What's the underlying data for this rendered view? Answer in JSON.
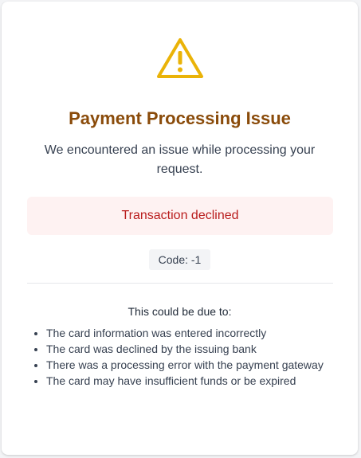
{
  "icon": "warning-triangle-icon",
  "title": "Payment Processing Issue",
  "message": "We encountered an issue while processing your request.",
  "error": {
    "text": "Transaction declined"
  },
  "code": "Code: -1",
  "reasons": {
    "heading": "This could be due to:",
    "items": [
      "The card information was entered incorrectly",
      "The card was declined by the issuing bank",
      "There was a processing error with the payment gateway",
      "The card may have insufficient funds or be expired"
    ]
  },
  "colors": {
    "warning": "#eab308",
    "title": "#8a4b0a",
    "error_text": "#b91c1c",
    "error_bg": "#fef2f2"
  }
}
